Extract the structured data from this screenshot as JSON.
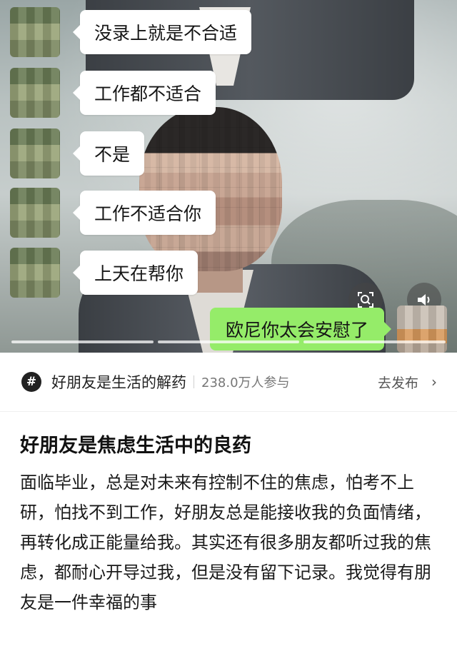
{
  "chat": {
    "messages": [
      {
        "text": "没录上就是不合适"
      },
      {
        "text": "工作都不适合"
      },
      {
        "text": "不是"
      },
      {
        "text": "工作不适合你"
      },
      {
        "text": "上天在帮你"
      }
    ],
    "my_message": {
      "text": "欧尼你太会安慰了"
    },
    "icons": [
      "search-icon",
      "sound-icon"
    ],
    "progress_segments": 3,
    "bubble_color": "#95ec69"
  },
  "topic": {
    "icon": "hash-icon",
    "name": "好朋友是生活的解药",
    "count": "238.0万人参与",
    "action": "去发布"
  },
  "post": {
    "title": "好朋友是焦虑生活中的良药",
    "body": "面临毕业，总是对未来有控制不住的焦虑，怕考不上研，怕找不到工作，好朋友总是能接收我的负面情绪，再转化成正能量给我。其实还有很多朋友都听过我的焦虑，都耐心开导过我，但是没有留下记录。我觉得有朋友是一件幸福的事"
  }
}
